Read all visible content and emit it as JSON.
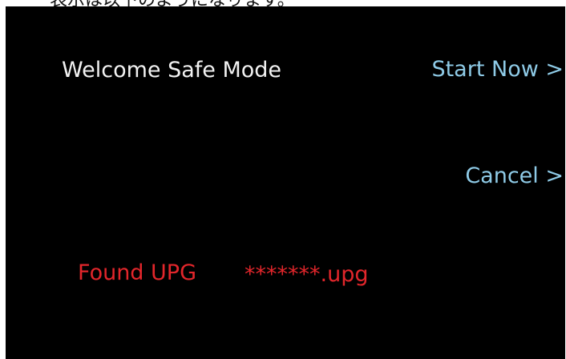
{
  "top_caption": "表示は以下のようになります。",
  "screen": {
    "title": "Welcome Safe Mode",
    "actions": {
      "start_now": "Start Now >",
      "cancel": "Cancel  >"
    },
    "upgrade": {
      "found_label": "Found UPG",
      "file_name": "*******.upg"
    }
  },
  "colors": {
    "background": "#000000",
    "title_text": "#f2f2f2",
    "action_text": "#8ecae6",
    "status_text": "#e2262b"
  }
}
